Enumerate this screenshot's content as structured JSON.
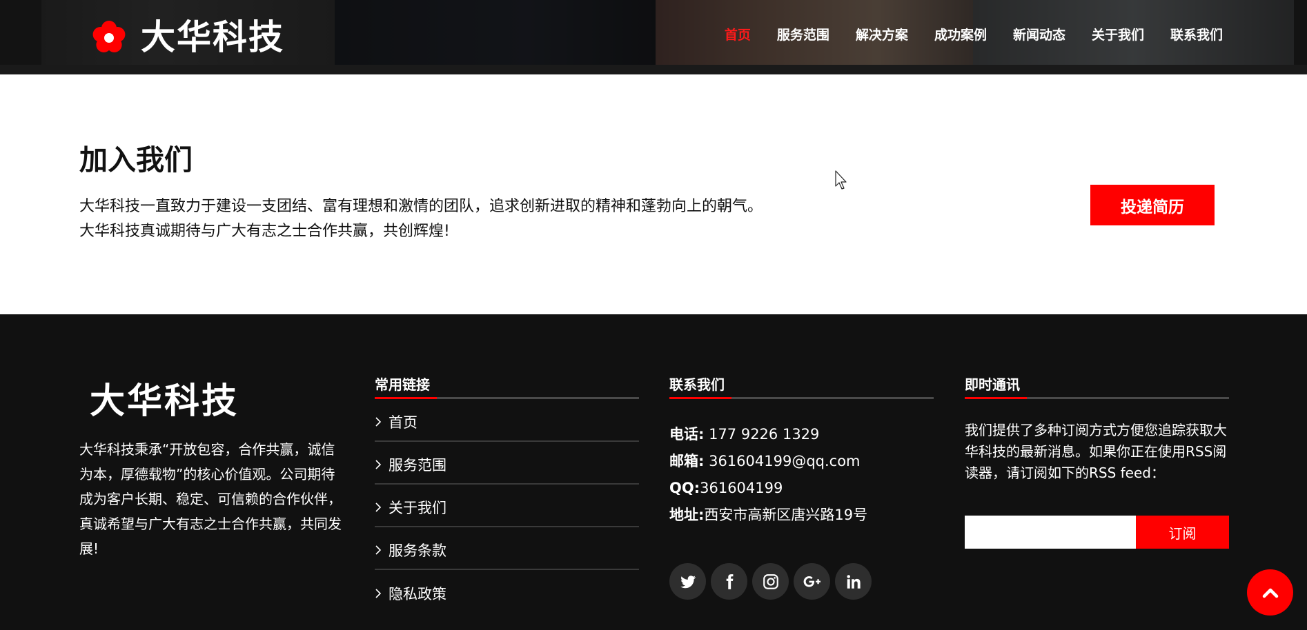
{
  "header": {
    "logo_text": "大华科技",
    "nav": [
      {
        "label": "首页",
        "active": true
      },
      {
        "label": "服务范围"
      },
      {
        "label": "解决方案"
      },
      {
        "label": "成功案例"
      },
      {
        "label": "新闻动态"
      },
      {
        "label": "关于我们"
      },
      {
        "label": "联系我们"
      }
    ]
  },
  "join": {
    "title": "加入我们",
    "line1": "大华科技一直致力于建设一支团结、富有理想和激情的团队，追求创新进取的精神和蓬勃向上的朝气。",
    "line2": "大华科技真诚期待与广大有志之士合作共赢，共创辉煌!",
    "button_label": "投递简历"
  },
  "footer": {
    "brand": "大华科技",
    "about": "大华科技秉承“开放包容，合作共赢，诚信为本，厚德载物”的核心价值观。公司期待成为客户长期、稳定、可信赖的合作伙伴，真诚希望与广大有志之士合作共赢，共同发展!",
    "links": {
      "title": "常用链接",
      "items": [
        "首页",
        "服务范围",
        "关于我们",
        "服务条款",
        "隐私政策"
      ]
    },
    "contact": {
      "title": "联系我们",
      "phone_label": "电话:",
      "phone": " 177 9226 1329",
      "email_label": "邮箱:",
      "email": " 361604199@qq.com",
      "qq_label": "QQ:",
      "qq": "361604199",
      "address_label": "地址:",
      "address": "西安市高新区唐兴路19号",
      "social": [
        "twitter-icon",
        "facebook-icon",
        "instagram-icon",
        "google-plus-icon",
        "linkedin-icon"
      ]
    },
    "news": {
      "title": "即时通讯",
      "text": "我们提供了多种订阅方式方便您追踪获取大华科技的最新消息。如果你正在使用RSS阅读器，请订阅如下的RSS feed：",
      "input_value": "",
      "subscribe_label": "订阅"
    }
  },
  "colors": {
    "accent": "#ff0000",
    "footer_bg": "#111111",
    "header_bg": "#1a1a1a"
  }
}
